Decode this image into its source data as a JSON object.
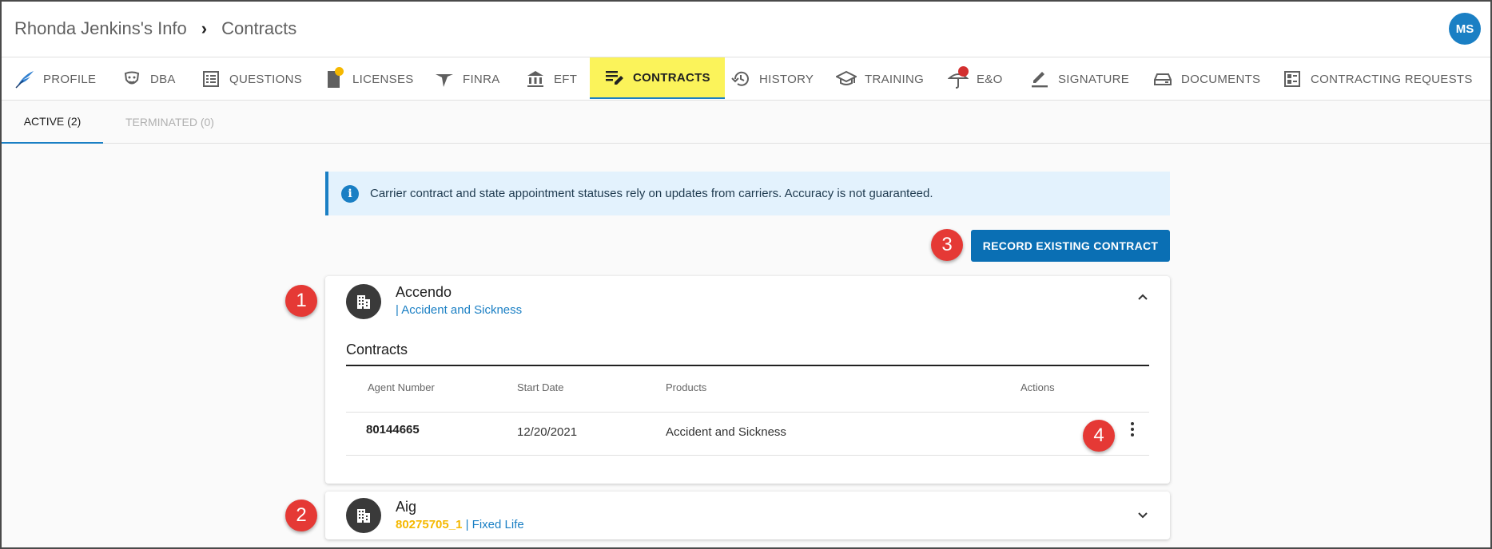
{
  "header": {
    "breadcrumb_root": "Rhonda Jenkins's Info",
    "breadcrumb_separator": "›",
    "breadcrumb_current": "Contracts",
    "avatar_initials": "MS"
  },
  "nav_tabs": [
    {
      "label": "PROFILE",
      "icon": "quill-icon"
    },
    {
      "label": "DBA",
      "icon": "mask-icon"
    },
    {
      "label": "QUESTIONS",
      "icon": "checklist-icon"
    },
    {
      "label": "LICENSES",
      "icon": "license-icon"
    },
    {
      "label": "FINRA",
      "icon": "finra-icon"
    },
    {
      "label": "EFT",
      "icon": "bank-icon"
    },
    {
      "label": "CONTRACTS",
      "icon": "edit-note-icon"
    },
    {
      "label": "HISTORY",
      "icon": "history-icon"
    },
    {
      "label": "TRAINING",
      "icon": "graduation-cap-icon"
    },
    {
      "label": "E&O",
      "icon": "umbrella-icon"
    },
    {
      "label": "SIGNATURE",
      "icon": "pen-icon"
    },
    {
      "label": "DOCUMENTS",
      "icon": "tray-icon"
    },
    {
      "label": "CONTRACTING REQUESTS",
      "icon": "request-list-icon"
    }
  ],
  "active_tab": "CONTRACTS",
  "sub_tabs": [
    {
      "label": "ACTIVE (2)",
      "state": "active"
    },
    {
      "label": "TERMINATED (0)",
      "state": "disabled"
    }
  ],
  "alert": {
    "icon": "info-icon",
    "text": "Carrier contract and state appointment statuses rely on updates from carriers. Accuracy is not guaranteed."
  },
  "record_button": "RECORD EXISTING CONTRACT",
  "cards": [
    {
      "name": "Accendo",
      "subtitle": "| Accident and Sickness",
      "expanded": true,
      "section_title": "Contracts",
      "columns": [
        "Agent Number",
        "Start Date",
        "Products",
        "Actions"
      ],
      "rows": [
        {
          "agent_number": "80144665",
          "start_date": "12/20/2021",
          "products": "Accident and Sickness"
        }
      ]
    },
    {
      "name": "Aig",
      "subtitle_number": "80275705_1",
      "subtitle": " | Fixed Life",
      "expanded": false
    }
  ],
  "markers": [
    "1",
    "2",
    "3",
    "4"
  ],
  "colors": {
    "accent": "#1a7fc4",
    "highlight": "#fbf35a",
    "marker": "#e53935",
    "agent_number_highlight": "#f5b800"
  }
}
